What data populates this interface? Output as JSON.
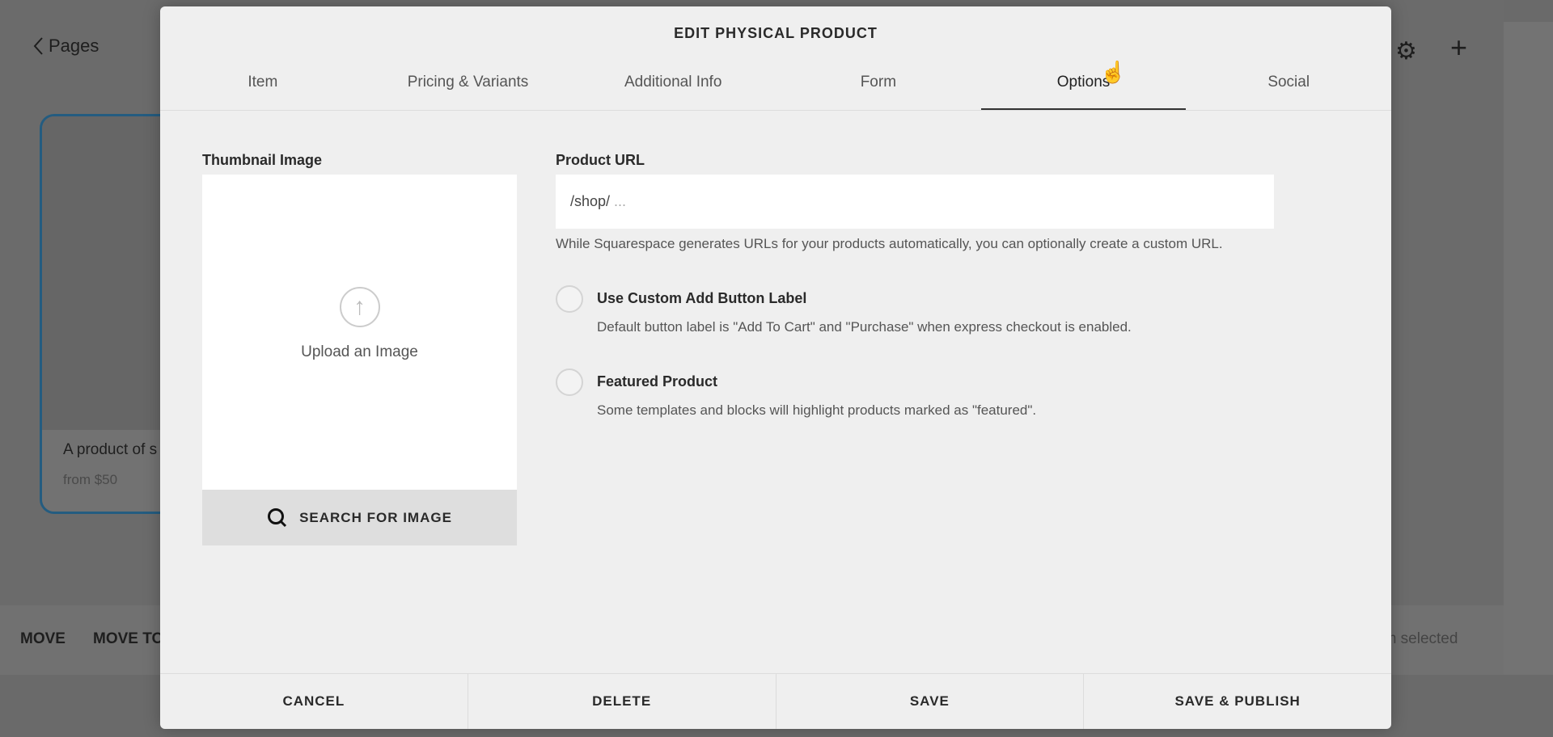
{
  "background": {
    "back_link": "Pages",
    "card": {
      "title": "A product of s",
      "price": "from $50"
    },
    "bottom_bar": {
      "move": "MOVE",
      "move_to": "MOVE TO",
      "selection": "em selected"
    }
  },
  "modal": {
    "title": "EDIT PHYSICAL PRODUCT",
    "tabs": [
      {
        "label": "Item"
      },
      {
        "label": "Pricing & Variants"
      },
      {
        "label": "Additional Info"
      },
      {
        "label": "Form"
      },
      {
        "label": "Options",
        "active": true
      },
      {
        "label": "Social"
      }
    ],
    "thumbnail": {
      "label": "Thumbnail Image",
      "upload_text": "Upload an Image",
      "search_label": "SEARCH FOR IMAGE"
    },
    "product_url": {
      "label": "Product URL",
      "prefix": "/shop/",
      "placeholder": "...",
      "help": "While Squarespace generates URLs for your products automatically, you can optionally create a custom URL."
    },
    "options": [
      {
        "label": "Use Custom Add Button Label",
        "description": "Default button label is \"Add To Cart\" and \"Purchase\" when express checkout is enabled.",
        "checked": false
      },
      {
        "label": "Featured Product",
        "description": "Some templates and blocks will highlight products marked as \"featured\".",
        "checked": false
      }
    ],
    "footer": {
      "cancel": "CANCEL",
      "delete": "DELETE",
      "save": "SAVE",
      "save_publish": "SAVE & PUBLISH"
    }
  }
}
